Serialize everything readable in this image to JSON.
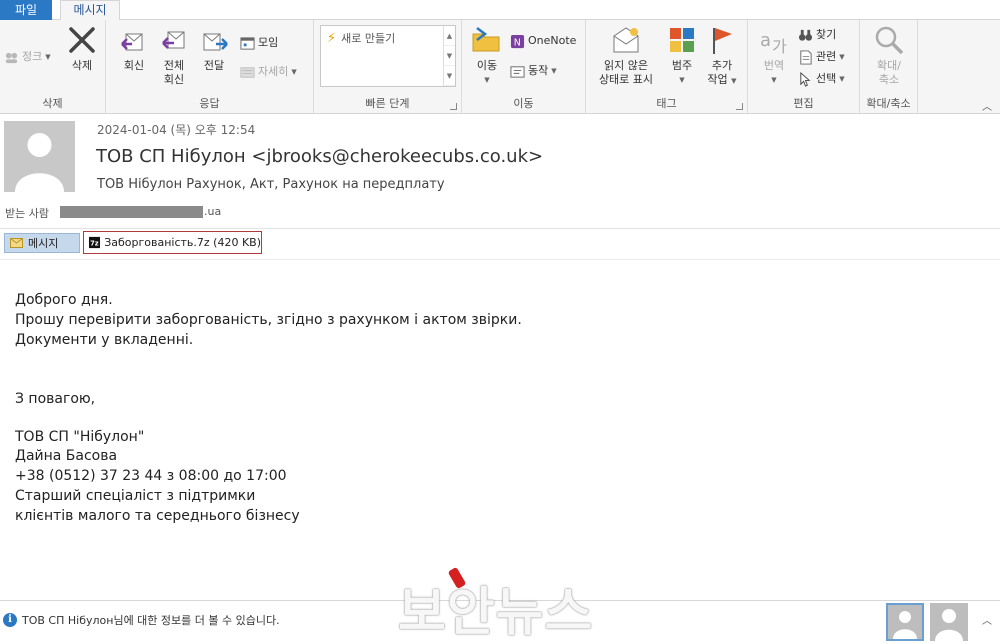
{
  "tabs": {
    "file": "파일",
    "message": "메시지"
  },
  "ribbon": {
    "delete_group": {
      "label": "삭제",
      "junk": "정크",
      "delete": "삭제"
    },
    "respond_group": {
      "label": "응답",
      "reply": "회신",
      "reply_all_line1": "전체",
      "reply_all_line2": "회신",
      "forward": "전달",
      "meeting": "모임",
      "more": "자세히"
    },
    "quick_steps_group": {
      "label": "빠른 단계",
      "new_item": "새로 만들기"
    },
    "move_group": {
      "label": "이동",
      "move": "이동",
      "onenote": "OneNote",
      "actions": "동작"
    },
    "tags_group": {
      "label": "태그",
      "unread_line1": "읽지 않은",
      "unread_line2": "상태로 표시",
      "categorize": "범주",
      "followup_line1": "추가",
      "followup_line2": "작업"
    },
    "editing_group": {
      "label": "편집",
      "translate": "번역",
      "find": "찾기",
      "related": "관련",
      "select": "선택"
    },
    "zoom_group": {
      "label": "확대/축소",
      "zoom_line1": "확대/",
      "zoom_line2": "축소"
    }
  },
  "message": {
    "date": "2024-01-04 (목) 오후 12:54",
    "sender": "ТОВ СП Нібулон <jbrooks@cherokeecubs.co.uk>",
    "subject": "ТОВ Нібулон Рахунок, Акт, Рахунок на передплату",
    "to_label": "받는 사람",
    "to_domain": ".ua",
    "message_tab": "메시지",
    "attachment": "Заборгованість.7z (420 KB)"
  },
  "body": {
    "lines": [
      "Доброго дня.",
      "Прошу перевірити заборгованість, згідно з рахунком і актом звірки.",
      "Документи у вкладенні.",
      "З повагою,",
      "ТОВ СП \"Нібулон\"",
      "Дайна Басова",
      "+38 (0512) 37 23 44 з 08:00 до 17:00",
      "Старший спеціаліст з підтримки",
      "клієнтів малого та середнього бізнесу"
    ]
  },
  "people_pane": {
    "info": "ТОВ СП Нібулон님에 대한 정보를 더 볼 수 있습니다."
  },
  "watermark": "보안뉴스",
  "colors": {
    "accent": "#2b78c5",
    "attachment_border": "#b03a3a",
    "message_tab_bg": "#c6d9ec"
  }
}
